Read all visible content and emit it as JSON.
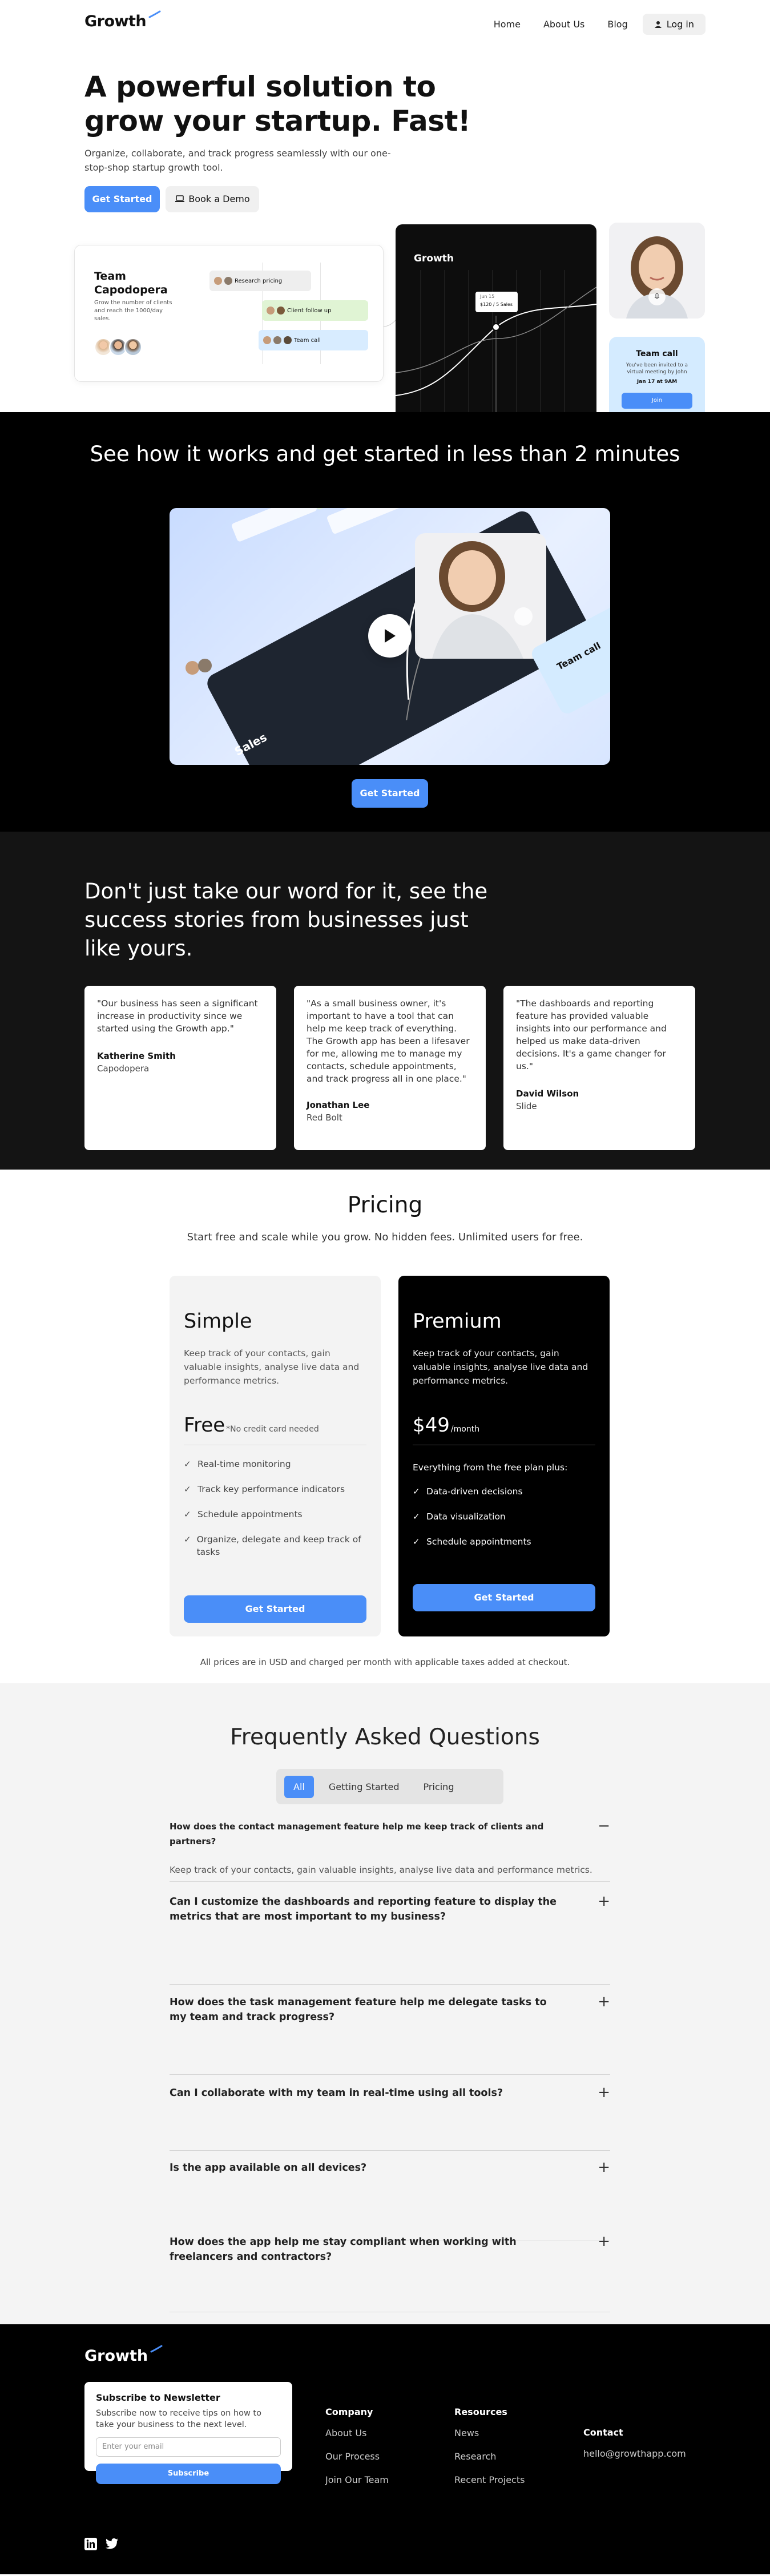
{
  "nav": {
    "logo": "Growth",
    "links": [
      "Home",
      "About Us",
      "Blog"
    ],
    "login": "Log in"
  },
  "hero": {
    "title": "A powerful solution to grow your startup. Fast!",
    "subtitle": "Organize, collaborate, and track progress seamlessly with our one-stop-shop startup growth tool.",
    "cta_primary": "Get Started",
    "cta_secondary": "Book a Demo",
    "team_card": {
      "title": "Team Capodopera",
      "desc": "Grow the number of clients and reach the 1000/day sales.",
      "tasks": [
        "Research pricing",
        "Client follow up",
        "Team call"
      ]
    },
    "growth_card": {
      "title": "Growth",
      "tooltip_line1": "Jun 15",
      "tooltip_line2": "$120 / 5 Sales"
    },
    "call_card": {
      "title": "Team call",
      "desc": "You've been invited to a virtual meeting by John",
      "date": "Jan 17 at 9AM",
      "join": "Join"
    }
  },
  "video": {
    "title": "See how it works and get started in less than 2 minutes",
    "cta": "Get Started",
    "labels": {
      "sales": "Sales",
      "team_call": "Team call"
    }
  },
  "testimonials": {
    "title": "Don't just take our word for it, see the success stories from businesses just like yours.",
    "items": [
      {
        "quote": "\"Our business has seen a significant increase in productivity since we started using the Growth app.\"",
        "name": "Katherine Smith",
        "company": "Capodopera"
      },
      {
        "quote": "\"As a small business owner, it's important to have a tool that can help me keep track of everything. The Growth app has been a lifesaver for me, allowing me to manage my contacts, schedule appointments, and track progress all in one place.\"",
        "name": "Jonathan Lee",
        "company": "Red Bolt"
      },
      {
        "quote": "\"The dashboards and reporting feature has provided valuable insights into our performance and helped us make data-driven decisions. It's a game changer for us.\"",
        "name": "David Wilson",
        "company": "Slide"
      }
    ]
  },
  "pricing": {
    "title": "Pricing",
    "subtitle": "Start free and scale while you grow. No hidden fees. Unlimited users for free.",
    "simple": {
      "name": "Simple",
      "desc": "Keep track of your contacts, gain valuable insights, analyse live data and performance metrics.",
      "price": "Free",
      "price_note": "*No credit card needed",
      "features": [
        "Real-time monitoring",
        "Track key performance indicators",
        "Schedule appointments",
        "Organize, delegate and keep track of tasks"
      ],
      "cta": "Get Started"
    },
    "premium": {
      "name": "Premium",
      "desc": "Keep track of your contacts, gain valuable insights, analyse live data and performance metrics.",
      "price": "$49",
      "price_note": "/month",
      "includes": "Everything from the free plan plus:",
      "features": [
        "Data-driven decisions",
        "Data visualization",
        "Schedule appointments"
      ],
      "cta": "Get Started"
    },
    "note": "All prices are in USD and charged per month with applicable taxes added at checkout."
  },
  "faq": {
    "title": "Frequently Asked Questions",
    "tabs": [
      "All",
      "Getting Started",
      "Pricing"
    ],
    "items": [
      {
        "q": "How does the contact management feature help me keep track of clients and partners?",
        "a": "Keep track of your contacts, gain valuable insights, analyse live data and performance metrics.",
        "toggle": "−"
      },
      {
        "q": "Can I customize the dashboards and reporting feature to display the metrics that are most important to my business?",
        "toggle": "+"
      },
      {
        "q": "How does the task management feature help me delegate tasks to my team and track progress?",
        "toggle": "+"
      },
      {
        "q": "Can I collaborate with my team in real-time using all tools?",
        "toggle": "+"
      },
      {
        "q": "Is the app available on all devices?",
        "toggle": "+"
      },
      {
        "q": "How does the app help me stay compliant when working with freelancers and contractors?",
        "toggle": "+"
      }
    ]
  },
  "footer": {
    "logo": "Growth",
    "newsletter": {
      "title": "Subscribe to Newsletter",
      "desc": "Subscribe now to receive tips on how to take your business to the next level.",
      "placeholder": "Enter your email",
      "button": "Subscribe"
    },
    "company": {
      "title": "Company",
      "links": [
        "About Us",
        "Our Process",
        "Join Our Team"
      ]
    },
    "resources": {
      "title": "Resources",
      "links": [
        "News",
        "Research",
        "Recent Projects"
      ]
    },
    "contact": {
      "title": "Contact",
      "email": "hello@growthapp.com"
    }
  },
  "colors": {
    "accent": "#4a8ef8",
    "dark": "#000000",
    "call_card": "#d4ebff"
  }
}
